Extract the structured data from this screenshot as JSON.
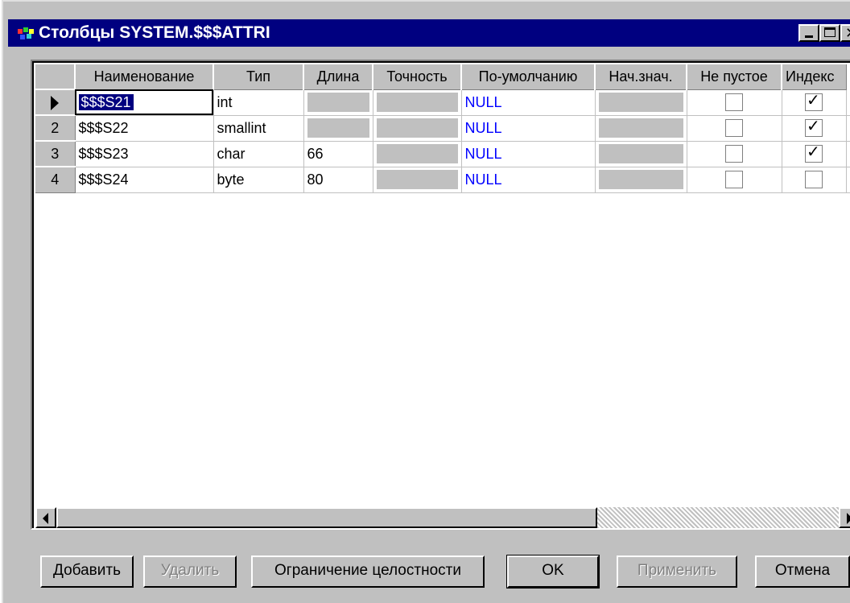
{
  "window": {
    "title": "Столбцы SYSTEM.$$$ATTRI",
    "icon": "app-icon"
  },
  "grid": {
    "columns": [
      "Наименование",
      "Тип",
      "Длина",
      "Точность",
      "По-умолчанию",
      "Нач.знач.",
      "Не пустое",
      "Индекс"
    ],
    "rows": [
      {
        "num": "",
        "current": true,
        "name": "$$$S21",
        "type": "int",
        "length": "",
        "precision": "",
        "default": "NULL",
        "initial": "",
        "not_null": false,
        "index": true
      },
      {
        "num": "2",
        "current": false,
        "name": "$$$S22",
        "type": "smallint",
        "length": "",
        "precision": "",
        "default": "NULL",
        "initial": "",
        "not_null": false,
        "index": true
      },
      {
        "num": "3",
        "current": false,
        "name": "$$$S23",
        "type": "char",
        "length": "66",
        "precision": "",
        "default": "NULL",
        "initial": "",
        "not_null": false,
        "index": true
      },
      {
        "num": "4",
        "current": false,
        "name": "$$$S24",
        "type": "byte",
        "length": "80",
        "precision": "",
        "default": "NULL",
        "initial": "",
        "not_null": false,
        "index": false
      }
    ]
  },
  "buttons": {
    "add": "Добавить",
    "delete": "Удалить",
    "constraints": "Ограничение целостности",
    "ok": "OK",
    "apply": "Применить",
    "cancel": "Отмена"
  },
  "colors": {
    "titlebar": "#000080",
    "face": "#c0c0c0",
    "null_text": "#0000ff",
    "selection": "#000080"
  }
}
